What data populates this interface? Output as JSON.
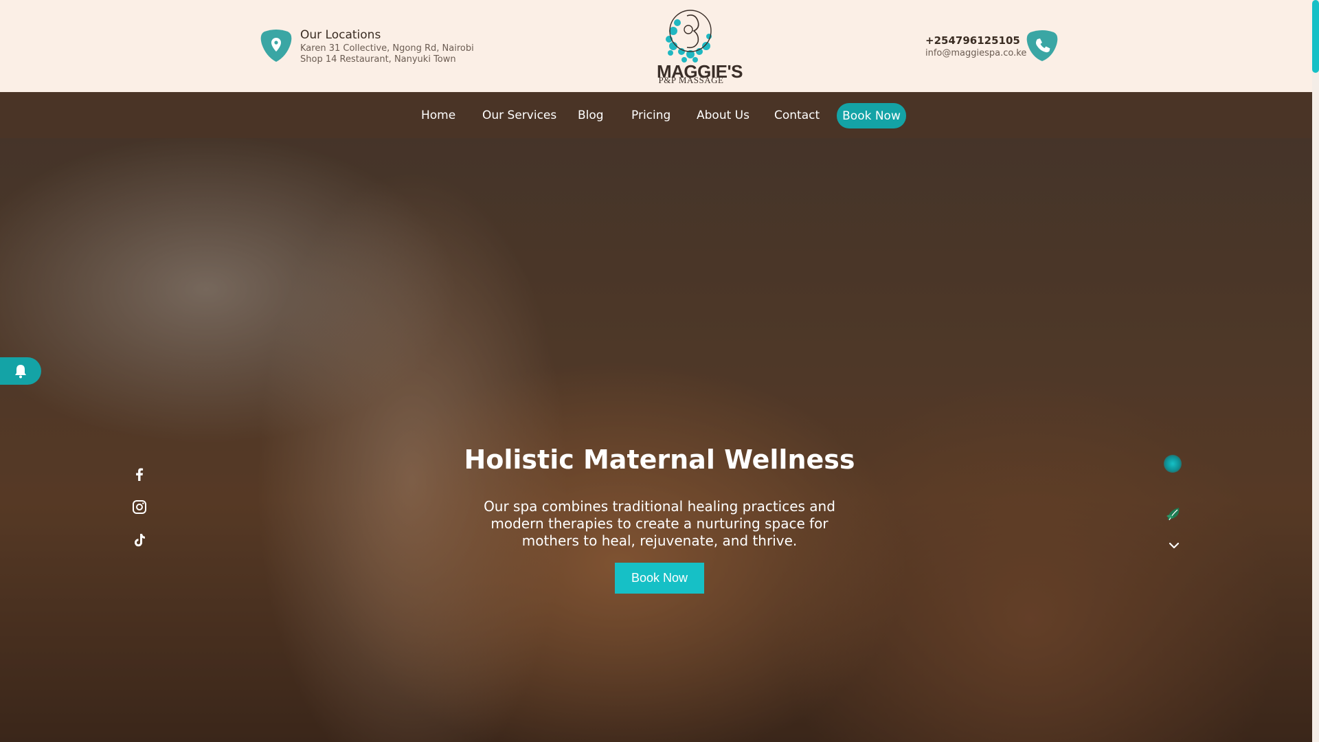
{
  "header": {
    "locations": {
      "title": "Our Locations",
      "line1": "Karen 31 Collective, Ngong Rd, Nairobi",
      "line2": "Shop 14 Restaurant, Nanyuki Town"
    },
    "logo": {
      "name": "MAGGIE'S",
      "subtitle": "P&P MASSAGE",
      "icon": "mother-baby-logo"
    },
    "contact": {
      "phone": "+254796125105",
      "email": "info@maggiespa.co.ke"
    }
  },
  "nav": {
    "items": [
      {
        "label": "Home"
      },
      {
        "label": "Our Services"
      },
      {
        "label": "Blog"
      },
      {
        "label": "Pricing"
      },
      {
        "label": "About Us"
      },
      {
        "label": "Contact"
      }
    ],
    "cta": "Book Now"
  },
  "hero": {
    "title": "Holistic Maternal Wellness",
    "text": "Our spa combines traditional healing practices and modern therapies to create a nurturing space for mothers to heal, rejuvenate, and thrive.",
    "button": "Book Now"
  },
  "social": [
    "facebook-icon",
    "instagram-icon",
    "tiktok-icon"
  ],
  "colors": {
    "accent": "#14a3a6",
    "nav_bg": "#4a3426",
    "header_bg": "#fbefe6"
  }
}
